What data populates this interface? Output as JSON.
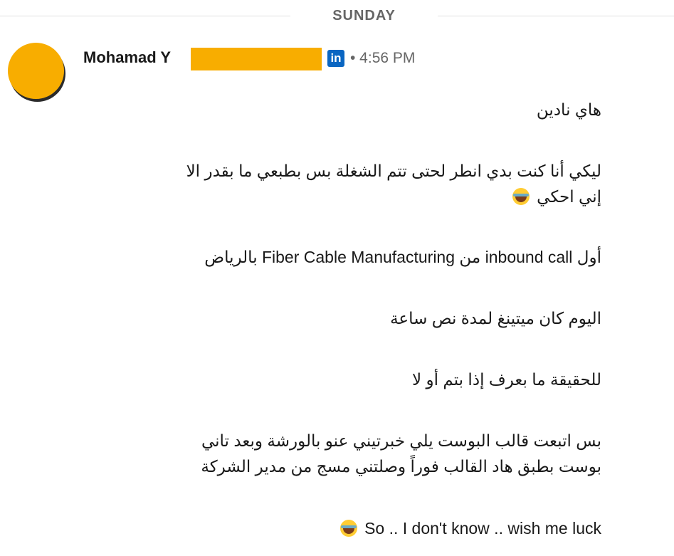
{
  "divider": {
    "label": "SUNDAY"
  },
  "header": {
    "sender_name": "Mohamad Y",
    "linkedin_badge": "in",
    "timestamp": "• 4:56 PM"
  },
  "messages": [
    {
      "text": "هاي نادين"
    },
    {
      "line1": "ليكي أنا كنت بدي انطر لحتى تتم الشغلة بس بطبعي ما بقدر الا",
      "line2": "إني احكي",
      "emoji": "face-with-tears-of-joy"
    },
    {
      "text": "أول inbound call من Fiber Cable Manufacturing بالرياض"
    },
    {
      "text": "اليوم كان ميتينغ لمدة نص ساعة"
    },
    {
      "text": "للحقيقة ما بعرف إذا بتم أو لا"
    },
    {
      "line1": "بس اتبعت قالب البوست يلي خبرتيني عنو بالورشة وبعد تاني",
      "line2": "بوست بطبق هاد القالب فوراً وصلتني مسج من مدير الشركة"
    },
    {
      "text": "So .. I don't know .. wish me luck",
      "emoji": "face-with-tears-of-joy"
    }
  ],
  "colors": {
    "avatar": "#f8ad00",
    "redaction": "#f8ad00",
    "linkedin": "#0a66c2",
    "divider_text": "#666666"
  }
}
